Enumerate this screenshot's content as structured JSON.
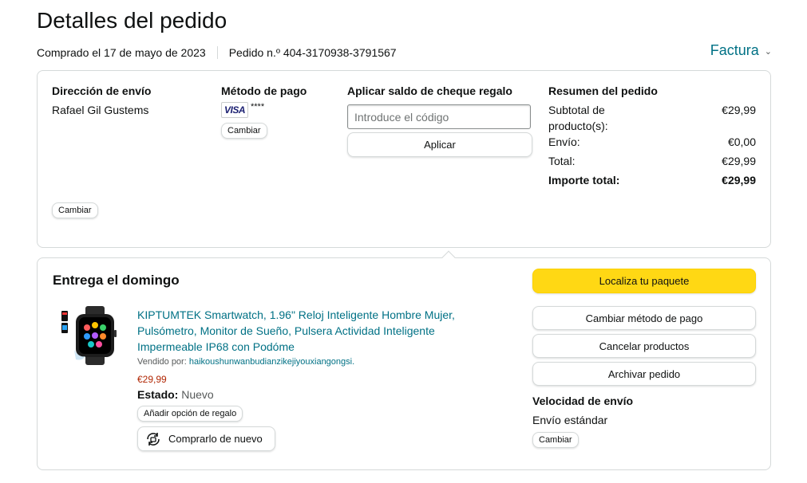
{
  "header": {
    "title": "Detalles del pedido",
    "purchased": "Comprado el 17 de mayo de 2023",
    "order_number": "Pedido n.º 404-3170938-3791567",
    "invoice_label": "Factura"
  },
  "shipping_address": {
    "title": "Dirección de envío",
    "name": "Rafael Gil Gustems",
    "change_label": "Cambiar"
  },
  "payment": {
    "title": "Método de pago",
    "card_brand": "VISA",
    "card_mask": "****",
    "change_label": "Cambiar"
  },
  "gift": {
    "title": "Aplicar saldo de cheque regalo",
    "placeholder": "Introduce el código",
    "apply_label": "Aplicar"
  },
  "summary": {
    "title": "Resumen del pedido",
    "rows": [
      {
        "label": "Subtotal de producto(s):",
        "value": "€29,99"
      },
      {
        "label": "Envío:",
        "value": "€0,00"
      },
      {
        "label": "Total:",
        "value": "€29,99"
      },
      {
        "label": "Importe total:",
        "value": "€29,99"
      }
    ]
  },
  "delivery": {
    "title": "Entrega el domingo",
    "product_title": "KIPTUMTEK Smartwatch, 1.96\" Reloj Inteligente Hombre Mujer, Pulsómetro, Monitor de Sueño, Pulsera Actividad Inteligente Impermeable IP68 con Podóme",
    "seller_prefix": "Vendido por:",
    "seller_name": "haikoushunwanbudianzikejiyouxiangongsi.",
    "price": "€29,99",
    "state_label": "Estado:",
    "state_value": "Nuevo",
    "gift_option_label": "Añadir opción de regalo",
    "buy_again_label": "Comprarlo de nuevo"
  },
  "actions": {
    "track": "Localiza tu paquete",
    "change_payment": "Cambiar método de pago",
    "cancel": "Cancelar productos",
    "archive": "Archivar pedido"
  },
  "shipping_speed": {
    "title": "Velocidad de envío",
    "value": "Envío estándar",
    "change_label": "Cambiar"
  },
  "colors": {
    "link": "#007185",
    "price": "#b12704",
    "primary_button": "#ffd814",
    "border": "#d5d9d9"
  }
}
